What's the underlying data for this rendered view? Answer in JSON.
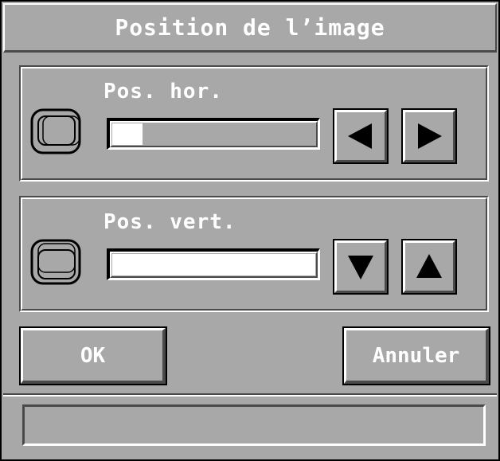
{
  "dialog": {
    "title": "Position de l’image",
    "horizontal": {
      "label": "Pos. hor.",
      "value_fraction": 0.15,
      "left_icon": "triangle-left-icon",
      "right_icon": "triangle-right-icon"
    },
    "vertical": {
      "label": "Pos. vert.",
      "value_fraction": 1.0,
      "down_icon": "triangle-down-icon",
      "up_icon": "triangle-up-icon"
    },
    "ok_label": "OK",
    "cancel_label": "Annuler",
    "status_text": ""
  },
  "colors": {
    "face": "#a8a8a8",
    "highlight": "#ffffff",
    "shadow": "#4a4a4a",
    "frame": "#000000"
  }
}
